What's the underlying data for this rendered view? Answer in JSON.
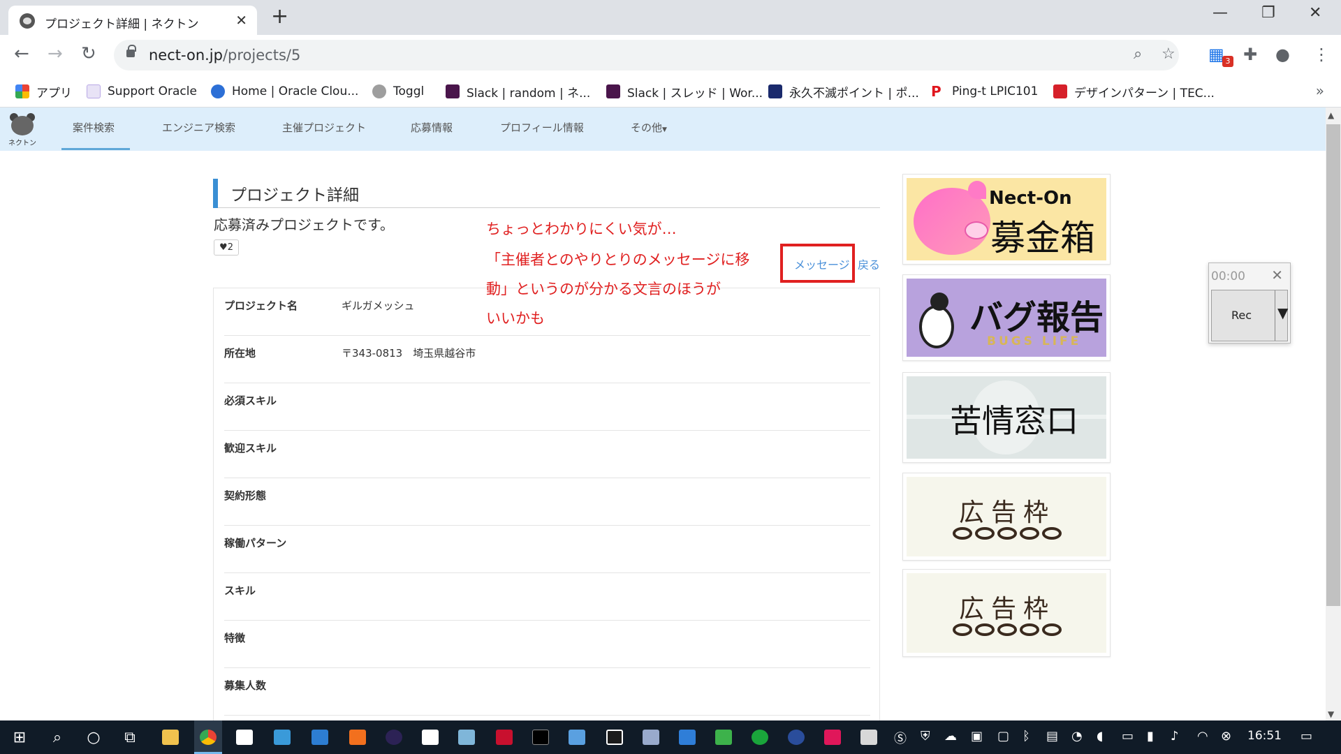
{
  "browser": {
    "tab_title": "プロジェクト詳細 | ネクトン",
    "url_host": "nect-on.jp",
    "url_path": "/projects/5",
    "extension_badge": "3",
    "bookmarks": [
      {
        "label": "アプリ",
        "icon": "apps-grid-icon",
        "color": "#4285f4"
      },
      {
        "label": "Support Oracle",
        "icon": "oracle-support-icon",
        "color": "#e8e3f6"
      },
      {
        "label": "Home | Oracle Clou...",
        "icon": "cloud-icon",
        "color": "#2c6fd6"
      },
      {
        "label": "Toggl",
        "icon": "power-icon",
        "color": "#9e9e9e"
      },
      {
        "label": "Slack | random | ネ...",
        "icon": "slack-icon",
        "color": "#4a154b"
      },
      {
        "label": "Slack | スレッド | Wor...",
        "icon": "slack-icon",
        "color": "#4a154b"
      },
      {
        "label": "永久不滅ポイント | ポ...",
        "icon": "chart-icon",
        "color": "#1a2a6c"
      },
      {
        "label": "Ping-t LPIC101",
        "icon": "ping-t-icon",
        "color": "#e0161e"
      },
      {
        "label": "デザインパターン | TEC...",
        "icon": "music-icon",
        "color": "#d6202a"
      }
    ]
  },
  "site": {
    "logo_text": "ネクトン",
    "nav": [
      "案件検索",
      "エンジニア検索",
      "主催プロジェクト",
      "応募情報",
      "プロフィール情報",
      "その他"
    ],
    "accent": "#3a8fd4",
    "header_bg": "#ddeefb"
  },
  "main": {
    "section_title": "プロジェクト詳細",
    "applied_text": "応募済みプロジェクトです。",
    "favorite_count": "2",
    "message_link": "メッセージ",
    "back_link": "戻る",
    "details": [
      {
        "label": "プロジェクト名",
        "value": "ギルガメッシュ"
      },
      {
        "label": "所在地",
        "value": "〒343-0813　埼玉県越谷市"
      },
      {
        "label": "必須スキル",
        "value": ""
      },
      {
        "label": "歓迎スキル",
        "value": ""
      },
      {
        "label": "契約形態",
        "value": ""
      },
      {
        "label": "稼働パターン",
        "value": ""
      },
      {
        "label": "スキル",
        "value": ""
      },
      {
        "label": "特徴",
        "value": ""
      },
      {
        "label": "募集人数",
        "value": ""
      }
    ]
  },
  "annotation": {
    "lines": [
      "ちょっとわかりにくい気が…",
      "「主催者とのやりとりのメッセージに移",
      "動」というのが分かる文言のほうが",
      "いいかも"
    ],
    "color": "#e02020"
  },
  "sidebar": {
    "banner1": {
      "brand": "Nect-On",
      "title": "募金箱"
    },
    "banner2": {
      "title": "バグ報告",
      "subtitle": "BUGS LIFE"
    },
    "banner3": {
      "title": "苦情窓口"
    },
    "banner4": {
      "title": "広告枠"
    },
    "banner5": {
      "title": "広告枠"
    }
  },
  "recorder": {
    "time": "00:00",
    "button": "Rec"
  },
  "taskbar": {
    "clock": "16:51"
  }
}
